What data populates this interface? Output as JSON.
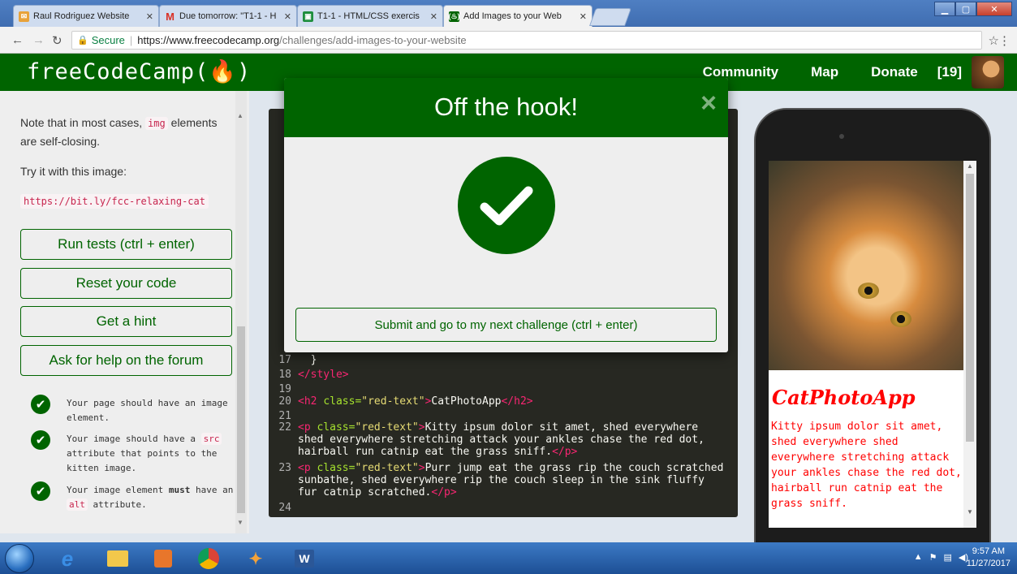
{
  "browser": {
    "tabs": [
      {
        "title": "Raul Rodriguez Website"
      },
      {
        "title": "Due tomorrow: \"T1-1 - H"
      },
      {
        "title": "T1-1 - HTML/CSS exercis"
      },
      {
        "title": "Add Images to your Web"
      }
    ],
    "address": {
      "secure_label": "Secure",
      "url_host": "https://www.freecodecamp.org",
      "url_path": "/challenges/add-images-to-your-website"
    }
  },
  "fcc_nav": {
    "logo": "freeCodeCamp(🔥)",
    "links": [
      "Community",
      "Map",
      "Donate"
    ],
    "points": "[19]"
  },
  "instructions": {
    "note_a": "Note that in most cases, ",
    "note_code": "img",
    "note_b": " elements are self-closing.",
    "try_text": "Try it with this image:",
    "image_url": "https://bit.ly/fcc-relaxing-cat",
    "buttons": {
      "run": "Run tests (ctrl + enter)",
      "reset": "Reset your code",
      "hint": "Get a hint",
      "help": "Ask for help on the forum"
    },
    "tests": [
      {
        "a": "Your page should have an image element.",
        "code": "",
        "b": ""
      },
      {
        "a": "Your image should have a ",
        "code": "src",
        "b": " attribute that points to the kitten image."
      },
      {
        "a": "Your image element ",
        "bold": "must",
        "c": " have an ",
        "code": "alt",
        "b": " attribute."
      }
    ]
  },
  "editor": {
    "line17": {
      "num": "17",
      "text": "  }"
    },
    "line18": {
      "num": "18",
      "text": "</style>"
    },
    "line19": {
      "num": "19",
      "text": ""
    },
    "line20": {
      "num": "20",
      "open": "<h2 ",
      "attr": "class=",
      "val": "\"red-text\"",
      "close": ">",
      "content": "CatPhotoApp",
      "end": "</h2>"
    },
    "line21": {
      "num": "21"
    },
    "line22": {
      "num": "22",
      "open": "<p ",
      "attr": "class=",
      "val": "\"red-text\"",
      "close": ">",
      "content": "Kitty ipsum dolor sit amet, shed everywhere shed everywhere stretching attack your ankles chase the red dot, hairball run catnip eat the grass sniff.",
      "end": "</p>"
    },
    "line23": {
      "num": "23",
      "open": "<p ",
      "attr": "class=",
      "val": "\"red-text\"",
      "close": ">",
      "content": "Purr jump eat the grass rip the couch scratched sunbathe, shed everywhere rip the couch sleep in the sink fluffy fur catnip scratched.",
      "end": "</p>"
    },
    "line24": {
      "num": "24"
    }
  },
  "preview": {
    "heading": "CatPhotoApp",
    "paragraph": "Kitty ipsum dolor sit amet, shed everywhere shed everywhere stretching attack your ankles chase the red dot, hairball run catnip eat the grass sniff."
  },
  "modal": {
    "title": "Off the hook!",
    "close": "×",
    "submit": "Submit and go to my next challenge (ctrl + enter)"
  },
  "taskbar": {
    "time": "9:57 AM",
    "date": "11/27/2017"
  },
  "colors": {
    "fcc_green": "#006400",
    "code_bg": "#272822",
    "preview_red": "#ff0000"
  }
}
